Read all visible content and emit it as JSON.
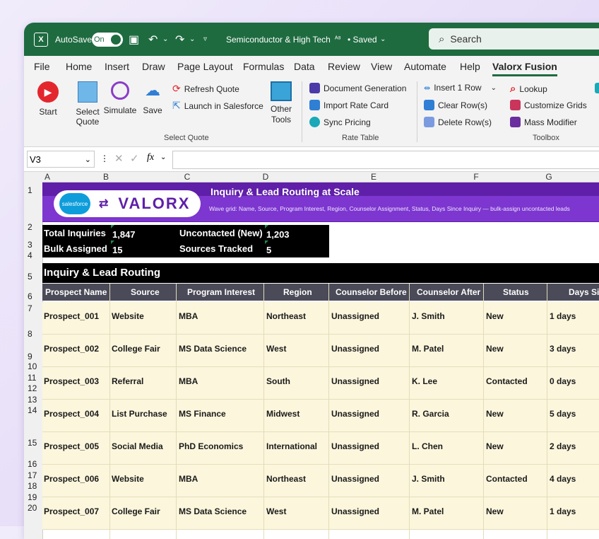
{
  "titlebar": {
    "app_icon": "excel-icon",
    "autosave_label": "AutoSave",
    "autosave_state": "On",
    "document_title": "Semiconductor & High Tech",
    "saved_status": "• Saved",
    "search_placeholder": "Search"
  },
  "menu": [
    "File",
    "Home",
    "Insert",
    "Draw",
    "Page Layout",
    "Formulas",
    "Data",
    "Review",
    "View",
    "Automate",
    "Help",
    "Valorx Fusion"
  ],
  "menu_active": "Valorx Fusion",
  "ribbon": {
    "start": "Start",
    "select_quote": "Select Quote",
    "simulate": "Simulate",
    "save": "Save",
    "refresh_quote": "Refresh Quote",
    "launch_salesforce": "Launch in Salesforce",
    "other_tools": "Other Tools",
    "group_select_quote": "Select Quote",
    "document_generation": "Document Generation",
    "import_rate_card": "Import Rate Card",
    "sync_pricing": "Sync Pricing",
    "group_rate_table": "Rate Table",
    "insert_row": "Insert 1 Row",
    "clear_rows": "Clear Row(s)",
    "delete_rows": "Delete Row(s)",
    "lookup": "Lookup",
    "customize_grids": "Customize Grids",
    "mass_modifier": "Mass Modifier",
    "group_toolbox": "Toolbox",
    "accent": "#1e6b40"
  },
  "formula_bar": {
    "cell_ref": "V3",
    "fx": "fx",
    "value": ""
  },
  "columns": [
    "A",
    "B",
    "C",
    "D",
    "E",
    "F",
    "G"
  ],
  "rows": [
    "1",
    "2",
    "3",
    "4",
    "5",
    "6",
    "7",
    "8",
    "9",
    "10",
    "11",
    "12",
    "13",
    "14",
    "15",
    "16",
    "17",
    "18",
    "19",
    "20"
  ],
  "banner": {
    "salesforce_logo_text": "salesforce",
    "valorx_logo_text": "VALORX",
    "title": "Inquiry & Lead Routing at Scale",
    "subtitle": "Wave grid: Name, Source, Program Interest, Region, Counselor Assignment, Status, Days Since Inquiry — bulk-assign uncontacted leads",
    "color": "#5f1fa8"
  },
  "stats": {
    "total_label": "Total Inquiries",
    "total_value": "1,847",
    "uncontacted_label": "Uncontacted (New)",
    "uncontacted_value": "1,203",
    "bulk_label": "Bulk Assigned",
    "bulk_value": "15",
    "sources_label": "Sources Tracked",
    "sources_value": "5"
  },
  "section_title": "Inquiry & Lead Routing",
  "table": {
    "headers": [
      "Prospect Name",
      "Source",
      "Program Interest",
      "Region",
      "Counselor Before",
      "Counselor After",
      "Status",
      "Days Since"
    ],
    "rows": [
      [
        "Prospect_001",
        "Website",
        "MBA",
        "Northeast",
        "Unassigned",
        "J. Smith",
        "New",
        "1 days"
      ],
      [
        "Prospect_002",
        "College Fair",
        "MS Data Science",
        "West",
        "Unassigned",
        "M. Patel",
        "New",
        "3 days"
      ],
      [
        "Prospect_003",
        "Referral",
        "MBA",
        "South",
        "Unassigned",
        "K. Lee",
        "Contacted",
        "0 days"
      ],
      [
        "Prospect_004",
        "List Purchase",
        "MS Finance",
        "Midwest",
        "Unassigned",
        "R. Garcia",
        "New",
        "5 days"
      ],
      [
        "Prospect_005",
        "Social Media",
        "PhD Economics",
        "International",
        "Unassigned",
        "L. Chen",
        "New",
        "2 days"
      ],
      [
        "Prospect_006",
        "Website",
        "MBA",
        "Northeast",
        "Unassigned",
        "J. Smith",
        "Contacted",
        "4 days"
      ],
      [
        "Prospect_007",
        "College Fair",
        "MS Data Science",
        "West",
        "Unassigned",
        "M. Patel",
        "New",
        "1 days"
      ]
    ]
  }
}
